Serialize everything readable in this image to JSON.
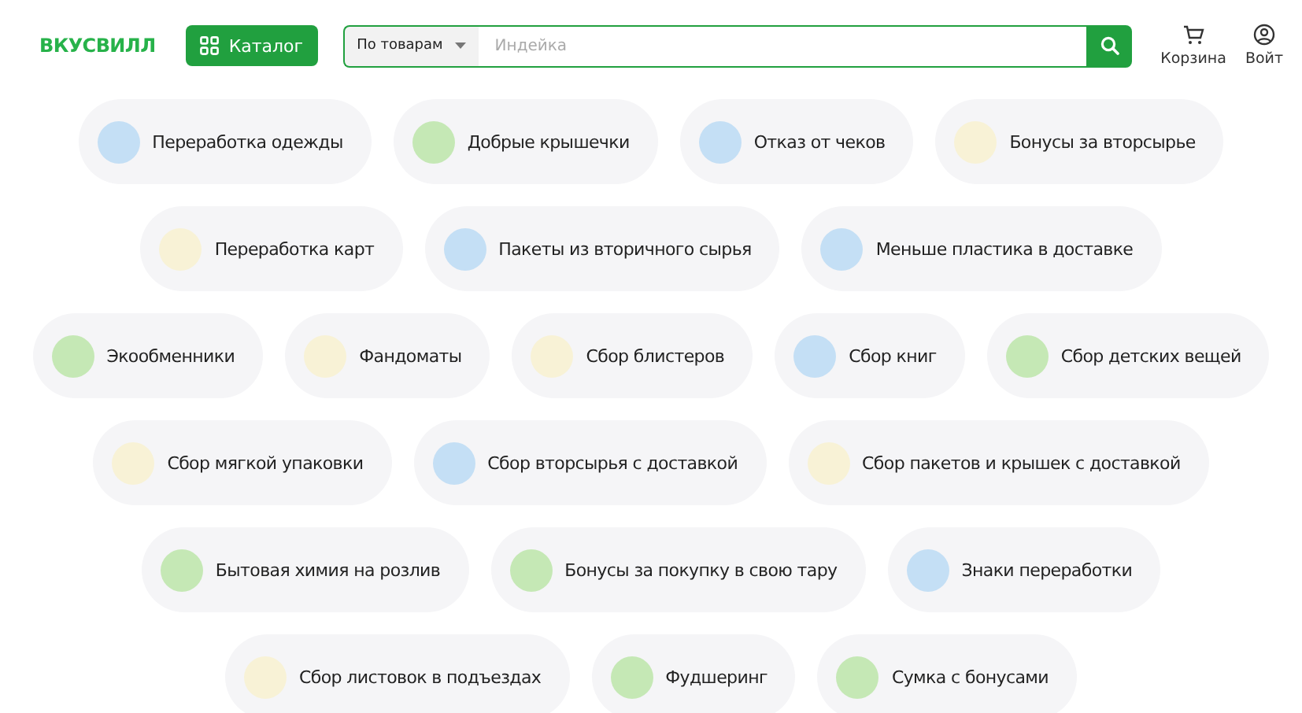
{
  "header": {
    "logo": "ВКУСВИЛЛ",
    "catalog_button": "Каталог",
    "search": {
      "scope": "По товарам",
      "placeholder": "Индейка"
    },
    "actions": [
      {
        "kind": "cart",
        "label": "Корзина"
      },
      {
        "kind": "user",
        "label": "Войт"
      }
    ]
  },
  "chip_rows": [
    [
      {
        "label": "Переработка одежды",
        "color": "#c4dff5"
      },
      {
        "label": "Добрые крышечки",
        "color": "#c5e8b5"
      },
      {
        "label": "Отказ от чеков",
        "color": "#c4dff5"
      },
      {
        "label": "Бонусы за вторсырье",
        "color": "#f8f2d6"
      }
    ],
    [
      {
        "label": "Переработка карт",
        "color": "#f8f2d6"
      },
      {
        "label": "Пакеты из вторичного сырья",
        "color": "#c4dff5"
      },
      {
        "label": "Меньше пластика в доставке",
        "color": "#c4dff5"
      }
    ],
    [
      {
        "label": "Экообменники",
        "color": "#c5e8b5"
      },
      {
        "label": "Фандоматы",
        "color": "#f8f2d6"
      },
      {
        "label": "Сбор блистеров",
        "color": "#f8f2d6"
      },
      {
        "label": "Сбор книг",
        "color": "#c4dff5"
      },
      {
        "label": "Сбор детских вещей",
        "color": "#c5e8b5"
      }
    ],
    [
      {
        "label": "Сбор мягкой упаковки",
        "color": "#f8f2d6"
      },
      {
        "label": "Сбор вторсырья с доставкой",
        "color": "#c4dff5"
      },
      {
        "label": "Сбор пакетов и крышек с доставкой",
        "color": "#f8f2d6"
      }
    ],
    [
      {
        "label": "Бытовая химия на розлив",
        "color": "#c5e8b5"
      },
      {
        "label": "Бонусы за покупку в свою тару",
        "color": "#c5e8b5"
      },
      {
        "label": "Знаки переработки",
        "color": "#c4dff5"
      }
    ],
    [
      {
        "label": "Сбор листовок в подъездах",
        "color": "#f8f2d6"
      },
      {
        "label": "Фудшеринг",
        "color": "#c5e8b5"
      },
      {
        "label": "Сумка с бонусами",
        "color": "#c5e8b5"
      }
    ]
  ]
}
